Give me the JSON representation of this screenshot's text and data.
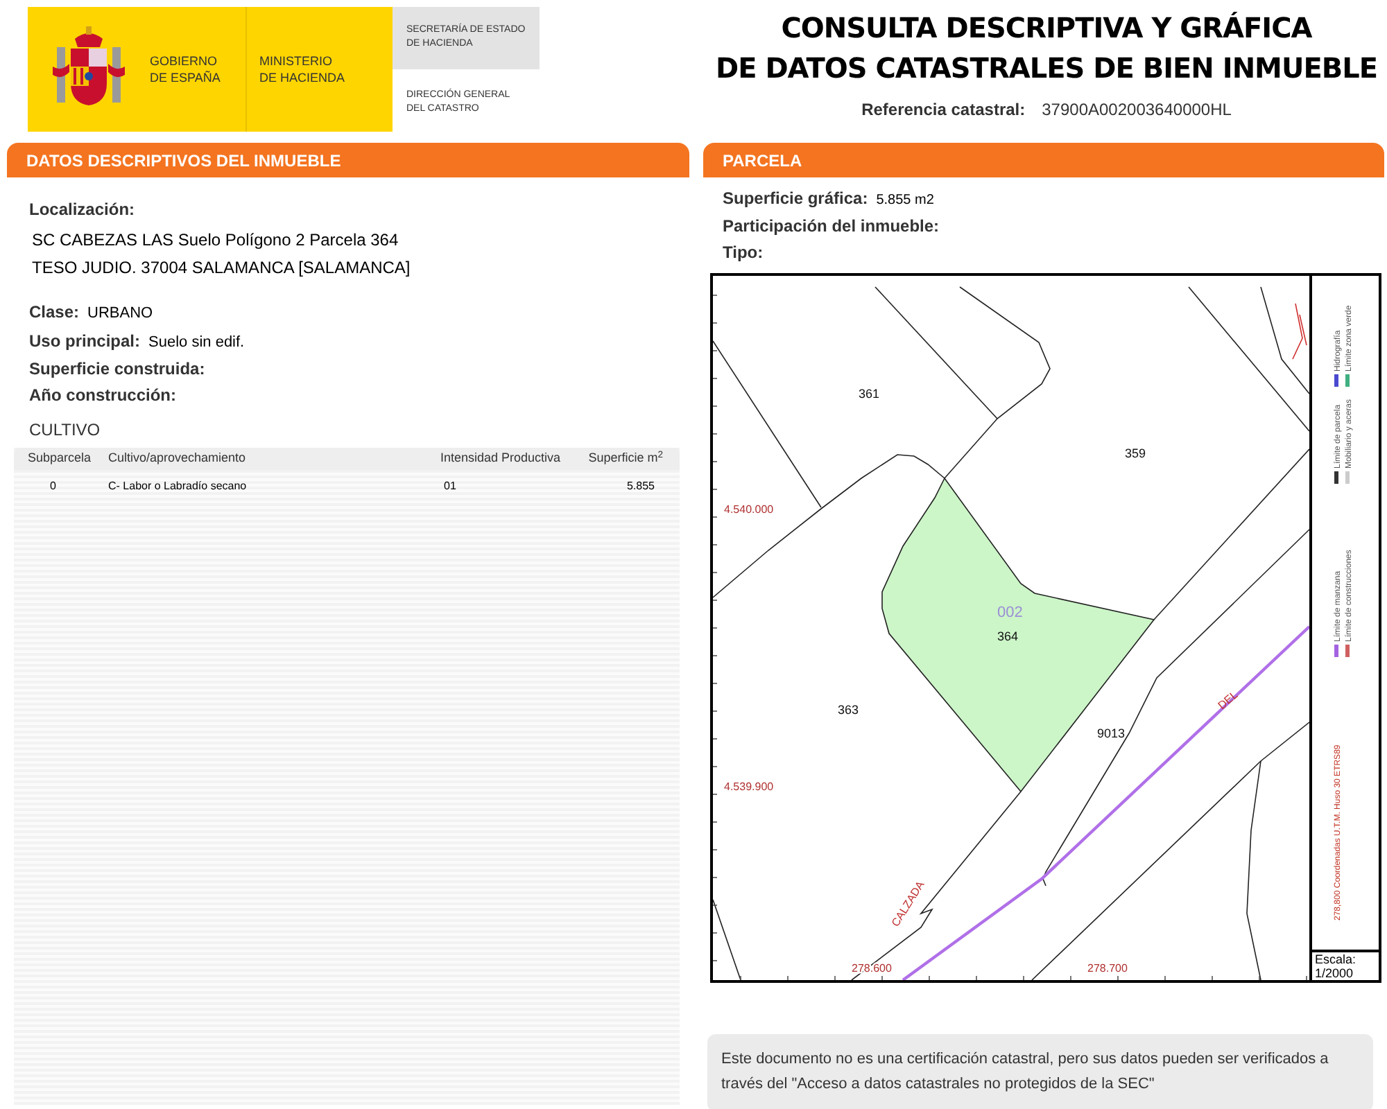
{
  "header": {
    "logo": {
      "government": [
        "GOBIERNO",
        "DE ESPAÑA"
      ],
      "ministry": [
        "MINISTERIO",
        "DE HACIENDA"
      ],
      "secretariat": [
        "SECRETARÍA DE ESTADO",
        "DE HACIENDA"
      ],
      "directorate": [
        "DIRECCIÓN GENERAL",
        "DEL CATASTRO"
      ]
    },
    "title": [
      "CONSULTA DESCRIPTIVA Y GRÁFICA",
      "DE DATOS CATASTRALES DE BIEN INMUEBLE"
    ],
    "reference": {
      "label": "Referencia catastral:",
      "value": "37900A002003640000HL"
    }
  },
  "descriptive": {
    "title": "DATOS DESCRIPTIVOS DEL INMUEBLE",
    "location": {
      "label": "Localización:",
      "lines": [
        "SC CABEZAS LAS  Suelo Polígono 2 Parcela 364",
        "TESO JUDIO. 37004 SALAMANCA [SALAMANCA]"
      ]
    },
    "fields": [
      {
        "label": "Clase:",
        "value": "URBANO"
      },
      {
        "label": "Uso principal:",
        "value": "Suelo sin edif."
      },
      {
        "label": "Superficie construida:"
      },
      {
        "label": "Año construcción:"
      }
    ],
    "cultivo": {
      "title": "CULTIVO",
      "columns": [
        "Subparcela",
        "Cultivo/aprovechamiento",
        "Intensidad Productiva",
        "Superficie m$^{2}$"
      ],
      "rows": [
        [
          "0",
          "C- Labor o Labradío secano",
          "01",
          "5.855"
        ]
      ]
    }
  },
  "parcel": {
    "title": "PARCELA",
    "fields": [
      {
        "label": "Superficie gráfica:",
        "value": "5.855 m2"
      },
      {
        "label": "Participación del inmueble:"
      },
      {
        "label": "Tipo:"
      }
    ],
    "map": {
      "labels": [
        {
          "kind": "parcel",
          "text": "361"
        },
        {
          "kind": "parcel",
          "text": "359"
        },
        {
          "kind": "subparcel",
          "text": "002"
        },
        {
          "kind": "parcel",
          "text": "364"
        },
        {
          "kind": "parcel",
          "text": "363"
        },
        {
          "kind": "parcel",
          "text": "9013"
        },
        {
          "kind": "street",
          "text": "DEL"
        },
        {
          "kind": "street",
          "text": "CALZADA"
        },
        {
          "kind": "coordinate",
          "text": "4.540.000"
        },
        {
          "kind": "coordinate",
          "text": "4.539.900"
        },
        {
          "kind": "coordinate",
          "text": "278.600"
        },
        {
          "kind": "coordinate",
          "text": "278.700"
        }
      ],
      "coordinates_note": "278,800 Coordenadas U.T.M. Huso 30 ETRS89",
      "legend": [
        {
          "label": "Límite de manzana",
          "color": "#a463e0"
        },
        {
          "label": "Límite de parcela",
          "color": "#333333"
        },
        {
          "label": "Hidrografía",
          "color": "#4a4ad0"
        },
        {
          "label": "Límite de construcciones",
          "color": "#d06060"
        },
        {
          "label": "Mobiliario y aceras",
          "color": "#cccccc"
        },
        {
          "label": "Límite zona verde",
          "color": "#40b080"
        }
      ],
      "scale": {
        "label": "Escala:",
        "value": "1/2000"
      }
    },
    "notice": "Este documento no es una certificación catastral, pero sus datos pueden ser verificados a través del \"Acceso a datos catastrales no protegidos de la SEC\""
  }
}
